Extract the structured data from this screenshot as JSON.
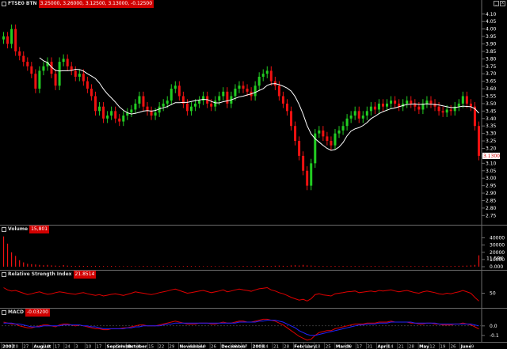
{
  "main": {
    "title": "FTSE0 BTN",
    "values": "3.25000, 3.26000, 3.12500, 3.13000, -0.12500",
    "last_price_tag": "3.1300",
    "y_ticks": [
      "4.10",
      "4.05",
      "4.00",
      "3.95",
      "3.90",
      "3.85",
      "3.80",
      "3.75",
      "3.70",
      "3.65",
      "3.60",
      "3.55",
      "3.50",
      "3.45",
      "3.40",
      "3.35",
      "3.30",
      "3.25",
      "3.20",
      "3.15",
      "3.10",
      "3.05",
      "3.00",
      "2.95",
      "2.90",
      "2.85",
      "2.80",
      "2.75"
    ]
  },
  "volume": {
    "title": "Volume",
    "values": "15,801",
    "y_ticks": [
      "40000",
      "30000",
      "20000",
      "10000",
      "0.000"
    ],
    "tag": "11.58K"
  },
  "rsi": {
    "title": "Relative Strength Index",
    "values": "21.8514",
    "y_ticks": [
      "50"
    ]
  },
  "macd": {
    "title": "MACD",
    "values": "-0.03200",
    "y_ticks": [
      "0.0",
      "-0.1"
    ]
  },
  "time_axis": {
    "labels": [
      {
        "t": "2007",
        "b": true
      },
      {
        "t": "20"
      },
      {
        "t": "27"
      },
      {
        "t": "August",
        "b": true
      },
      {
        "t": "10"
      },
      {
        "t": "17"
      },
      {
        "t": "24"
      },
      {
        "t": "3"
      },
      {
        "t": "10"
      },
      {
        "t": "17"
      },
      {
        "t": "September",
        "b": true
      },
      {
        "t": "24"
      },
      {
        "t": "October",
        "b": true
      },
      {
        "t": "8"
      },
      {
        "t": "15"
      },
      {
        "t": "22"
      },
      {
        "t": "29"
      },
      {
        "t": "November",
        "b": true
      },
      {
        "t": "12"
      },
      {
        "t": "19"
      },
      {
        "t": "26"
      },
      {
        "t": "December",
        "b": true
      },
      {
        "t": "10"
      },
      {
        "t": "17"
      },
      {
        "t": "2008",
        "b": true
      },
      {
        "t": "14"
      },
      {
        "t": "21"
      },
      {
        "t": "28"
      },
      {
        "t": "February",
        "b": true
      },
      {
        "t": "11"
      },
      {
        "t": "18"
      },
      {
        "t": "25"
      },
      {
        "t": "March",
        "b": true
      },
      {
        "t": "10"
      },
      {
        "t": "17"
      },
      {
        "t": "31"
      },
      {
        "t": "April",
        "b": true
      },
      {
        "t": "14"
      },
      {
        "t": "21"
      },
      {
        "t": "28"
      },
      {
        "t": "May",
        "b": true
      },
      {
        "t": "12"
      },
      {
        "t": "19"
      },
      {
        "t": "26"
      },
      {
        "t": "June",
        "b": true
      },
      {
        "t": "9"
      }
    ]
  },
  "colors": {
    "up": "#22cc22",
    "down": "#ee1111",
    "ma": "#ffffff",
    "indicator": "#e00000",
    "signal": "#2222ff",
    "grid": "#6a6a6a"
  },
  "chart_data": [
    {
      "type": "candlestick",
      "title": "FTSE0 BTN",
      "ylim": [
        2.72,
        4.12
      ],
      "moving_average": true,
      "ohlc_close_series": [
        3.95,
        3.9,
        4.0,
        3.85,
        3.82,
        3.78,
        3.75,
        3.7,
        3.6,
        3.72,
        3.75,
        3.78,
        3.7,
        3.62,
        3.78,
        3.8,
        3.75,
        3.72,
        3.68,
        3.7,
        3.65,
        3.6,
        3.55,
        3.45,
        3.48,
        3.4,
        3.42,
        3.45,
        3.4,
        3.38,
        3.42,
        3.44,
        3.46,
        3.5,
        3.55,
        3.48,
        3.45,
        3.42,
        3.44,
        3.48,
        3.5,
        3.52,
        3.6,
        3.62,
        3.55,
        3.5,
        3.45,
        3.48,
        3.5,
        3.52,
        3.55,
        3.5,
        3.48,
        3.52,
        3.55,
        3.58,
        3.5,
        3.55,
        3.6,
        3.62,
        3.6,
        3.58,
        3.55,
        3.62,
        3.68,
        3.7,
        3.72,
        3.65,
        3.62,
        3.55,
        3.5,
        3.45,
        3.35,
        3.25,
        3.15,
        3.05,
        2.95,
        3.1,
        3.3,
        3.32,
        3.28,
        3.25,
        3.22,
        3.3,
        3.32,
        3.35,
        3.4,
        3.42,
        3.45,
        3.4,
        3.42,
        3.45,
        3.48,
        3.46,
        3.5,
        3.48,
        3.5,
        3.52,
        3.5,
        3.48,
        3.5,
        3.52,
        3.5,
        3.48,
        3.46,
        3.5,
        3.52,
        3.5,
        3.48,
        3.45,
        3.44,
        3.46,
        3.45,
        3.48,
        3.5,
        3.55,
        3.5,
        3.48,
        3.35,
        3.15
      ]
    },
    {
      "type": "bar",
      "title": "Volume",
      "ylim": [
        0,
        45000
      ],
      "values": [
        42000,
        32000,
        20000,
        15000,
        9000,
        6000,
        4000,
        3500,
        3000,
        2500,
        2000,
        2500,
        1800,
        1500,
        1200,
        2200,
        1500,
        1200,
        1000,
        1300,
        1100,
        1000,
        900,
        1200,
        1000,
        900,
        800,
        1100,
        900,
        800,
        700,
        900,
        800,
        700,
        800,
        1000,
        900,
        800,
        700,
        900,
        800,
        700,
        800,
        900,
        700,
        800,
        1000,
        900,
        800,
        900,
        700,
        800,
        900,
        800,
        700,
        900,
        800,
        700,
        800,
        900,
        1000,
        900,
        800,
        900,
        1200,
        1100,
        1000,
        900,
        1300,
        1500,
        1200,
        1000,
        1800,
        2000,
        1600,
        2500,
        1800,
        1500,
        1200,
        1000,
        900,
        800,
        900,
        1000,
        800,
        900,
        700,
        800,
        900,
        800,
        700,
        800,
        900,
        1000,
        800,
        700,
        900,
        800,
        700,
        900,
        800,
        700,
        900,
        800,
        700,
        800,
        900,
        700,
        800,
        900,
        1000,
        800,
        900,
        1100,
        1200,
        1300,
        1500,
        1800,
        2500,
        15801
      ]
    },
    {
      "type": "line",
      "title": "Relative Strength Index",
      "ylim": [
        0,
        100
      ],
      "values": [
        70,
        62,
        58,
        60,
        55,
        50,
        45,
        48,
        52,
        55,
        50,
        46,
        48,
        52,
        55,
        53,
        50,
        48,
        46,
        50,
        52,
        48,
        45,
        42,
        45,
        40,
        43,
        46,
        48,
        45,
        42,
        46,
        50,
        55,
        52,
        50,
        47,
        45,
        48,
        52,
        55,
        58,
        62,
        65,
        60,
        55,
        50,
        52,
        55,
        58,
        60,
        56,
        52,
        55,
        58,
        62,
        55,
        58,
        62,
        65,
        62,
        60,
        57,
        62,
        66,
        68,
        70,
        62,
        58,
        52,
        48,
        42,
        35,
        30,
        25,
        28,
        22,
        30,
        45,
        48,
        44,
        42,
        40,
        48,
        50,
        52,
        55,
        56,
        58,
        52,
        54,
        56,
        58,
        55,
        60,
        58,
        60,
        62,
        58,
        55,
        58,
        60,
        56,
        52,
        50,
        55,
        58,
        55,
        52,
        48,
        46,
        50,
        48,
        52,
        55,
        60,
        55,
        50,
        35,
        21.85
      ]
    },
    {
      "type": "line",
      "title": "MACD",
      "series": [
        {
          "values": [
            0.04,
            0.03,
            0.02,
            0.02,
            0.0,
            -0.01,
            -0.02,
            -0.02,
            -0.01,
            0.0,
            0.01,
            0.01,
            0.0,
            -0.01,
            0.01,
            0.02,
            0.02,
            0.01,
            0.0,
            0.01,
            0.0,
            -0.01,
            -0.02,
            -0.03,
            -0.03,
            -0.04,
            -0.04,
            -0.03,
            -0.03,
            -0.03,
            -0.02,
            -0.02,
            -0.01,
            0.0,
            0.01,
            0.01,
            0.0,
            0.0,
            0.0,
            0.01,
            0.02,
            0.03,
            0.04,
            0.05,
            0.04,
            0.03,
            0.02,
            0.02,
            0.02,
            0.03,
            0.03,
            0.03,
            0.02,
            0.02,
            0.03,
            0.04,
            0.03,
            0.03,
            0.04,
            0.05,
            0.05,
            0.04,
            0.04,
            0.05,
            0.06,
            0.07,
            0.07,
            0.06,
            0.05,
            0.03,
            0.01,
            -0.02,
            -0.05,
            -0.08,
            -0.11,
            -0.13,
            -0.15,
            -0.14,
            -0.1,
            -0.07,
            -0.06,
            -0.05,
            -0.05,
            -0.03,
            -0.02,
            -0.01,
            0.0,
            0.01,
            0.02,
            0.02,
            0.02,
            0.03,
            0.03,
            0.03,
            0.04,
            0.04,
            0.04,
            0.05,
            0.04,
            0.04,
            0.04,
            0.04,
            0.03,
            0.03,
            0.02,
            0.02,
            0.03,
            0.03,
            0.02,
            0.02,
            0.01,
            0.01,
            0.01,
            0.02,
            0.02,
            0.03,
            0.02,
            0.01,
            -0.01,
            -0.032
          ]
        },
        {
          "values": [
            0.03,
            0.03,
            0.03,
            0.02,
            0.02,
            0.01,
            0.0,
            -0.01,
            -0.01,
            -0.01,
            0.0,
            0.0,
            0.0,
            0.0,
            0.0,
            0.01,
            0.01,
            0.01,
            0.01,
            0.01,
            0.0,
            0.0,
            -0.01,
            -0.01,
            -0.02,
            -0.03,
            -0.03,
            -0.03,
            -0.03,
            -0.03,
            -0.03,
            -0.02,
            -0.02,
            -0.01,
            -0.01,
            0.0,
            0.0,
            0.0,
            0.0,
            0.0,
            0.01,
            0.02,
            0.02,
            0.03,
            0.03,
            0.03,
            0.03,
            0.03,
            0.03,
            0.03,
            0.03,
            0.03,
            0.03,
            0.03,
            0.03,
            0.03,
            0.03,
            0.03,
            0.03,
            0.04,
            0.04,
            0.04,
            0.04,
            0.04,
            0.05,
            0.05,
            0.06,
            0.06,
            0.06,
            0.05,
            0.04,
            0.02,
            0.0,
            -0.02,
            -0.05,
            -0.07,
            -0.09,
            -0.1,
            -0.1,
            -0.09,
            -0.08,
            -0.07,
            -0.06,
            -0.05,
            -0.04,
            -0.03,
            -0.02,
            -0.01,
            0.0,
            0.01,
            0.01,
            0.02,
            0.02,
            0.02,
            0.03,
            0.03,
            0.03,
            0.04,
            0.04,
            0.04,
            0.04,
            0.04,
            0.04,
            0.03,
            0.03,
            0.03,
            0.03,
            0.03,
            0.03,
            0.02,
            0.02,
            0.02,
            0.02,
            0.02,
            0.02,
            0.02,
            0.02,
            0.02,
            0.01,
            0.0
          ]
        }
      ],
      "ylim": [
        -0.16,
        0.09
      ]
    }
  ]
}
